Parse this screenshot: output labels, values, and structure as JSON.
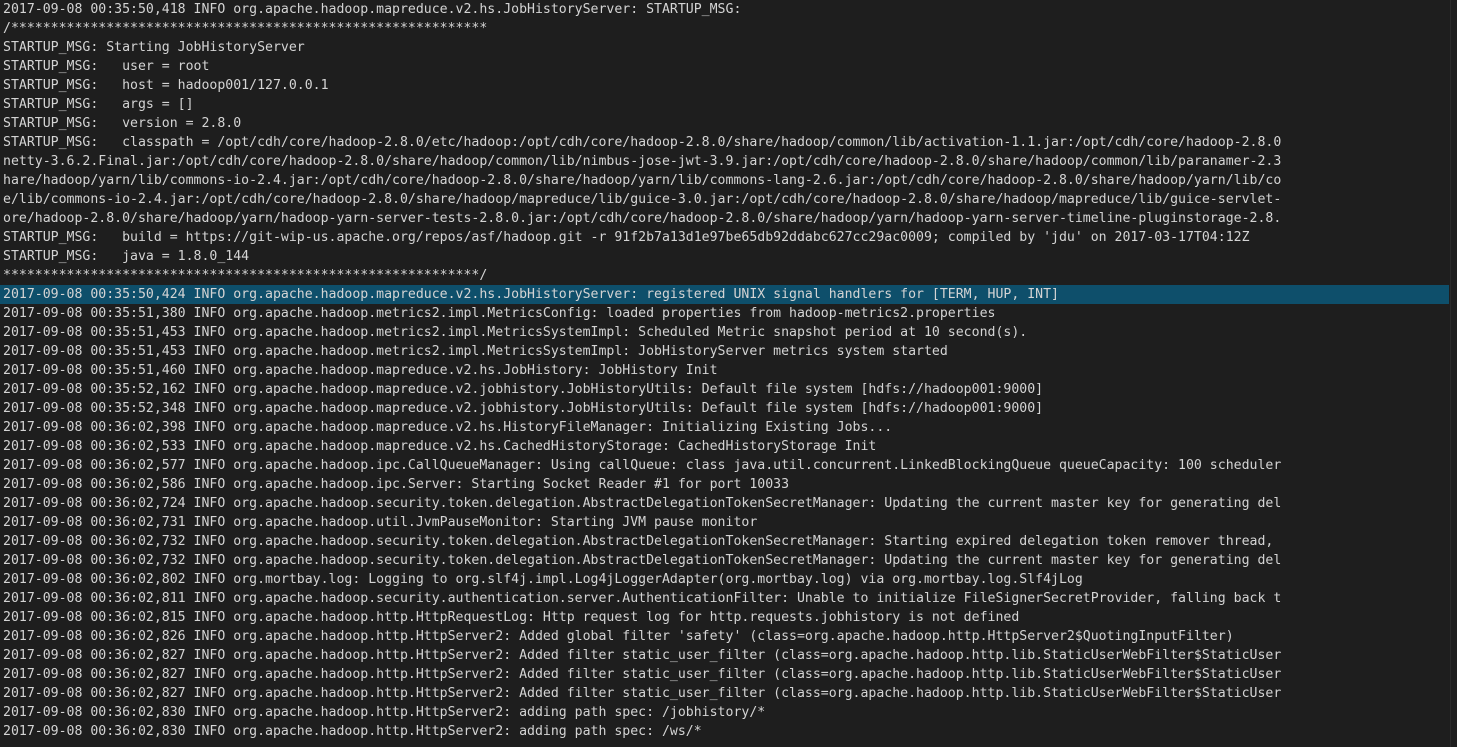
{
  "terminal": {
    "highlight_color": "#0e4f6b",
    "text_color": "#d4d4d4",
    "background_color": "#1e1e1e",
    "lines": [
      "2017-09-08 00:35:50,418 INFO org.apache.hadoop.mapreduce.v2.hs.JobHistoryServer: STARTUP_MSG:",
      "/************************************************************",
      "STARTUP_MSG: Starting JobHistoryServer",
      "STARTUP_MSG:   user = root",
      "STARTUP_MSG:   host = hadoop001/127.0.0.1",
      "STARTUP_MSG:   args = []",
      "STARTUP_MSG:   version = 2.8.0",
      "STARTUP_MSG:   classpath = /opt/cdh/core/hadoop-2.8.0/etc/hadoop:/opt/cdh/core/hadoop-2.8.0/share/hadoop/common/lib/activation-1.1.jar:/opt/cdh/core/hadoop-2.8.0",
      "netty-3.6.2.Final.jar:/opt/cdh/core/hadoop-2.8.0/share/hadoop/common/lib/nimbus-jose-jwt-3.9.jar:/opt/cdh/core/hadoop-2.8.0/share/hadoop/common/lib/paranamer-2.3",
      "hare/hadoop/yarn/lib/commons-io-2.4.jar:/opt/cdh/core/hadoop-2.8.0/share/hadoop/yarn/lib/commons-lang-2.6.jar:/opt/cdh/core/hadoop-2.8.0/share/hadoop/yarn/lib/co",
      "e/lib/commons-io-2.4.jar:/opt/cdh/core/hadoop-2.8.0/share/hadoop/mapreduce/lib/guice-3.0.jar:/opt/cdh/core/hadoop-2.8.0/share/hadoop/mapreduce/lib/guice-servlet-",
      "ore/hadoop-2.8.0/share/hadoop/yarn/hadoop-yarn-server-tests-2.8.0.jar:/opt/cdh/core/hadoop-2.8.0/share/hadoop/yarn/hadoop-yarn-server-timeline-pluginstorage-2.8.",
      "STARTUP_MSG:   build = https://git-wip-us.apache.org/repos/asf/hadoop.git -r 91f2b7a13d1e97be65db92ddabc627cc29ac0009; compiled by 'jdu' on 2017-03-17T04:12Z",
      "STARTUP_MSG:   java = 1.8.0_144",
      "************************************************************/",
      "2017-09-08 00:35:50,424 INFO org.apache.hadoop.mapreduce.v2.hs.JobHistoryServer: registered UNIX signal handlers for [TERM, HUP, INT]",
      "2017-09-08 00:35:51,380 INFO org.apache.hadoop.metrics2.impl.MetricsConfig: loaded properties from hadoop-metrics2.properties",
      "2017-09-08 00:35:51,453 INFO org.apache.hadoop.metrics2.impl.MetricsSystemImpl: Scheduled Metric snapshot period at 10 second(s).",
      "2017-09-08 00:35:51,453 INFO org.apache.hadoop.metrics2.impl.MetricsSystemImpl: JobHistoryServer metrics system started",
      "2017-09-08 00:35:51,460 INFO org.apache.hadoop.mapreduce.v2.hs.JobHistory: JobHistory Init",
      "2017-09-08 00:35:52,162 INFO org.apache.hadoop.mapreduce.v2.jobhistory.JobHistoryUtils: Default file system [hdfs://hadoop001:9000]",
      "2017-09-08 00:35:52,348 INFO org.apache.hadoop.mapreduce.v2.jobhistory.JobHistoryUtils: Default file system [hdfs://hadoop001:9000]",
      "2017-09-08 00:36:02,398 INFO org.apache.hadoop.mapreduce.v2.hs.HistoryFileManager: Initializing Existing Jobs...",
      "2017-09-08 00:36:02,533 INFO org.apache.hadoop.mapreduce.v2.hs.CachedHistoryStorage: CachedHistoryStorage Init",
      "2017-09-08 00:36:02,577 INFO org.apache.hadoop.ipc.CallQueueManager: Using callQueue: class java.util.concurrent.LinkedBlockingQueue queueCapacity: 100 scheduler",
      "2017-09-08 00:36:02,586 INFO org.apache.hadoop.ipc.Server: Starting Socket Reader #1 for port 10033",
      "2017-09-08 00:36:02,724 INFO org.apache.hadoop.security.token.delegation.AbstractDelegationTokenSecretManager: Updating the current master key for generating del",
      "2017-09-08 00:36:02,731 INFO org.apache.hadoop.util.JvmPauseMonitor: Starting JVM pause monitor",
      "2017-09-08 00:36:02,732 INFO org.apache.hadoop.security.token.delegation.AbstractDelegationTokenSecretManager: Starting expired delegation token remover thread,",
      "2017-09-08 00:36:02,732 INFO org.apache.hadoop.security.token.delegation.AbstractDelegationTokenSecretManager: Updating the current master key for generating del",
      "2017-09-08 00:36:02,802 INFO org.mortbay.log: Logging to org.slf4j.impl.Log4jLoggerAdapter(org.mortbay.log) via org.mortbay.log.Slf4jLog",
      "2017-09-08 00:36:02,811 INFO org.apache.hadoop.security.authentication.server.AuthenticationFilter: Unable to initialize FileSignerSecretProvider, falling back t",
      "2017-09-08 00:36:02,815 INFO org.apache.hadoop.http.HttpRequestLog: Http request log for http.requests.jobhistory is not defined",
      "2017-09-08 00:36:02,826 INFO org.apache.hadoop.http.HttpServer2: Added global filter 'safety' (class=org.apache.hadoop.http.HttpServer2$QuotingInputFilter)",
      "2017-09-08 00:36:02,827 INFO org.apache.hadoop.http.HttpServer2: Added filter static_user_filter (class=org.apache.hadoop.http.lib.StaticUserWebFilter$StaticUser",
      "2017-09-08 00:36:02,827 INFO org.apache.hadoop.http.HttpServer2: Added filter static_user_filter (class=org.apache.hadoop.http.lib.StaticUserWebFilter$StaticUser",
      "2017-09-08 00:36:02,827 INFO org.apache.hadoop.http.HttpServer2: Added filter static_user_filter (class=org.apache.hadoop.http.lib.StaticUserWebFilter$StaticUser",
      "2017-09-08 00:36:02,830 INFO org.apache.hadoop.http.HttpServer2: adding path spec: /jobhistory/*",
      "2017-09-08 00:36:02,830 INFO org.apache.hadoop.http.HttpServer2: adding path spec: /ws/*"
    ],
    "highlighted_line_index": 15
  }
}
